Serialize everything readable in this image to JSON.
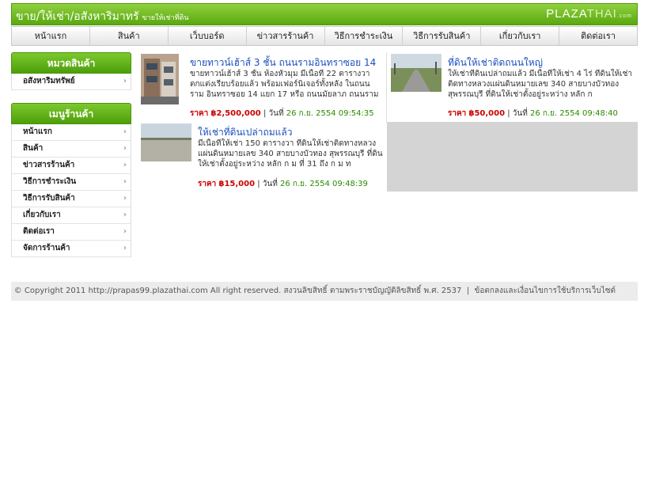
{
  "header": {
    "title": "ขาย/ให้เช่า/อสังหาริมาทรั",
    "subtitle": "ขายให้เช่าที่ดิน",
    "logo_main": "PLAZA",
    "logo_thai": "THAI",
    "logo_com": ".com"
  },
  "nav": {
    "items": [
      "หน้าแรก",
      "สินค้า",
      "เว็บบอร์ด",
      "ข่าวสารร้านค้า",
      "วิธีการชำระเงิน",
      "วิธีการรับสินค้า",
      "เกี่ยวกับเรา",
      "ติดต่อเรา"
    ]
  },
  "sidebar": {
    "category_title": "หมวดสินค้า",
    "categories": [
      "อสังหาริมทรัพย์"
    ],
    "menu_title": "เมนูร้านค้า",
    "menu": [
      "หน้าแรก",
      "สินค้า",
      "ข่าวสารร้านค้า",
      "วิธีการชำระเงิน",
      "วิธีการรับสินค้า",
      "เกี่ยวกับเรา",
      "ติดต่อเรา",
      "จัดการร้านค้า"
    ],
    "chevron": "›"
  },
  "products": [
    {
      "name": "ขายทาวน์เฮ้าส์ 3 ชั้น ถนนรามอินทราซอย 14",
      "desc": "ขายทาวน์เฮ้าส์ 3 ชั้น ห้องหัวมุม มีเนื้อที่ 22 ตารางวา ตกแต่งเรียบร้อยแล้ว พร้อมเฟอร์นิเจอร์ทั้งหลัง ในถนนราม อินทราซอย 14 แยก 17 หรือ ถนนมัยลาภ ถนนราม",
      "price_label": "ราคา",
      "price": "฿2,500,000",
      "date_label": "วันที่",
      "date": "26 ก.ย. 2554 09:54:35"
    },
    {
      "name": "ที่ดินให้เช่าติดถนนใหญ่",
      "desc": "ให้เช่าที่ดินเปล่าถมแล้ว มีเนื้อที่ให้เช่า 4 ไร่ ที่ดินให้เช่า ติดทางหลวงแผ่นดินหมายเลข 340 สายบางบัวทอง สุพรรณบุรี ที่ดินให้เช่าตั้งอยู่ระหว่าง หลัก ก",
      "price_label": "ราคา",
      "price": "฿50,000",
      "date_label": "วันที่",
      "date": "26 ก.ย. 2554 09:48:40"
    },
    {
      "name": "ให้เช่าที่ดินเปล่าถมแล้ว",
      "desc": "มีเนื้อที่ให้เช่า 150 ตารางวา ที่ดินให้เช่าติดทางหลวงแผ่นดินหมายเลข 340 สายบางบัวทอง สุพรรณบุรี ที่ดินให้เช่าตั้งอยู่ระหว่าง หลัก ก ม ที่ 31 ถึง ก ม ท",
      "price_label": "ราคา",
      "price": "฿15,000",
      "date_label": "วันที่",
      "date": "26 ก.ย. 2554 09:48:39"
    }
  ],
  "footer": {
    "copyright": "© Copyright 2011 http://prapas99.plazathai.com All right reserved. สงวนลิขสิทธิ์ ตามพระราชบัญญัติลิขสิทธิ์ พ.ศ. 2537",
    "separator": "|",
    "terms_link": "ข้อตกลงและเงื่อนไขการใช้บริการเว็บไซต์"
  }
}
